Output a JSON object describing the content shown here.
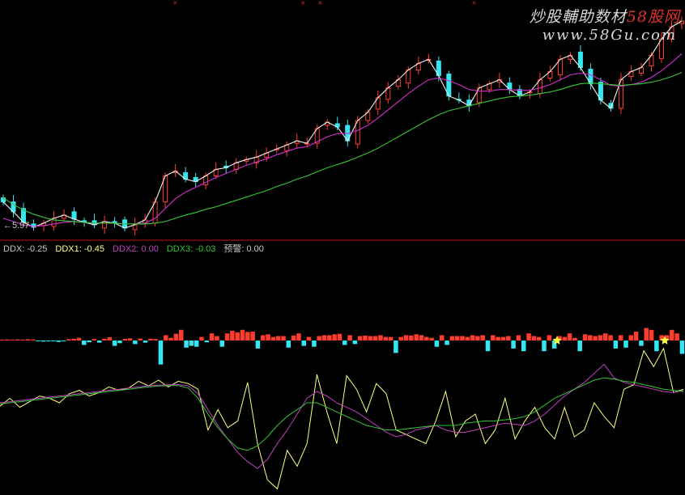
{
  "watermark": {
    "line1": "炒股輔助数材",
    "line1_brand": "58股网",
    "line2": "www.58Gu.com"
  },
  "colors": {
    "background": "#000000",
    "up": "#ff3d2e",
    "down": "#35e6f0",
    "ma_white": "#f0f0f0",
    "ma_magenta": "#d030d0",
    "ma_green": "#34c834",
    "divider": "#c0141e",
    "ddx": "#c8c8c8",
    "ddx1": "#ffff80",
    "ddx2": "#c040c0",
    "ddx3": "#34c834",
    "warn": "#c8c8c8",
    "star": "#ffff40"
  },
  "price_panel": {
    "low_marker": "←5.97"
  },
  "indicator_legend": [
    {
      "label": "DDX: -0.25",
      "color": "#c8c8c8"
    },
    {
      "label": "DDX1: -0.45",
      "color": "#ffff80"
    },
    {
      "label": "DDX2: 0.00",
      "color": "#c040c0"
    },
    {
      "label": "DDX3: -0.03",
      "color": "#34c834"
    },
    {
      "label": "预警: 0.00",
      "color": "#c8c8c8"
    }
  ],
  "chart_data": [
    {
      "type": "line",
      "panel": "price",
      "series": [
        {
          "values": [
            6.3,
            6.18,
            6.05,
            5.99,
            6.04,
            6.1,
            6.14,
            6.09,
            6.05,
            6.02,
            6.06,
            6.04,
            5.98,
            6.02,
            6.08,
            6.3,
            6.62,
            6.68,
            6.58,
            6.55,
            6.62,
            6.7,
            6.72,
            6.78,
            6.82,
            6.85,
            6.9,
            6.95,
            7.0,
            7.05,
            7.02,
            7.2,
            7.28,
            7.22,
            7.05,
            7.3,
            7.4,
            7.58,
            7.7,
            7.8,
            7.92,
            8.0,
            8.05,
            7.85,
            7.6,
            7.55,
            7.48,
            7.7,
            7.75,
            7.8,
            7.68,
            7.6,
            7.65,
            7.8,
            7.9,
            8.05,
            8.1,
            7.95,
            7.75,
            7.55,
            7.45,
            7.8,
            7.9,
            7.95,
            8.1,
            8.3,
            8.45,
            8.52
          ]
        },
        {
          "values": [
            6.1,
            6.06,
            6.02,
            6.0,
            6.01,
            6.03,
            6.05,
            6.06,
            6.05,
            6.04,
            6.04,
            6.04,
            6.03,
            6.03,
            6.04,
            6.1,
            6.22,
            6.34,
            6.42,
            6.48,
            6.54,
            6.6,
            6.65,
            6.7,
            6.75,
            6.79,
            6.83,
            6.88,
            6.92,
            6.96,
            6.98,
            7.04,
            7.1,
            7.14,
            7.14,
            7.18,
            7.24,
            7.33,
            7.43,
            7.53,
            7.63,
            7.72,
            7.8,
            7.82,
            7.79,
            7.74,
            7.68,
            7.66,
            7.66,
            7.68,
            7.68,
            7.67,
            7.67,
            7.7,
            7.74,
            7.8,
            7.86,
            7.88,
            7.86,
            7.8,
            7.73,
            7.72,
            7.74,
            7.77,
            7.83,
            7.91,
            8.01,
            8.12
          ]
        },
        {
          "values": [
            6.35,
            6.27,
            6.2,
            6.15,
            6.11,
            6.08,
            6.07,
            6.06,
            6.05,
            6.04,
            6.04,
            6.04,
            6.03,
            6.03,
            6.03,
            6.04,
            6.06,
            6.1,
            6.14,
            6.17,
            6.21,
            6.24,
            6.28,
            6.32,
            6.36,
            6.4,
            6.44,
            6.49,
            6.53,
            6.58,
            6.62,
            6.67,
            6.72,
            6.76,
            6.8,
            6.85,
            6.9,
            6.96,
            7.03,
            7.1,
            7.17,
            7.24,
            7.31,
            7.37,
            7.42,
            7.45,
            7.48,
            7.51,
            7.54,
            7.57,
            7.59,
            7.6,
            7.61,
            7.63,
            7.65,
            7.68,
            7.72,
            7.75,
            7.76,
            7.75,
            7.74,
            7.73,
            7.74,
            7.75,
            7.77,
            7.8,
            7.84,
            7.89
          ]
        }
      ]
    },
    {
      "type": "bar",
      "panel": "ddx",
      "values": [
        0.05,
        0.06,
        0.05,
        0.06,
        0.05,
        0.07,
        0.06,
        -0.04,
        -0.06,
        -0.05,
        -0.04,
        -0.08,
        -0.05,
        0.07,
        0.1,
        0.15,
        -0.25,
        -0.1,
        0.08,
        -0.12,
        0.1,
        0.18,
        -0.3,
        -0.15,
        0.09,
        0.12,
        -0.2,
        0.11,
        -0.12,
        0.1,
        0.08,
        -1.35,
        0.3,
        0.15,
        0.38,
        0.6,
        -0.4,
        -0.3,
        -0.35,
        0.2,
        -0.1,
        0.4,
        0.25,
        -0.35,
        0.4,
        0.55,
        0.45,
        0.6,
        0.48,
        0.5,
        -0.45,
        0.3,
        0.35,
        0.2,
        0.25,
        0.25,
        -0.4,
        0.28,
        0.4,
        -0.3,
        0.2,
        -0.35,
        0.25,
        0.3,
        0.3,
        0.35,
        0.38,
        -0.25,
        0.3,
        -0.2,
        0.25,
        0.28,
        0.25,
        0.25,
        0.3,
        0.2,
        0.2,
        -0.7,
        0.2,
        0.3,
        0.28,
        0.35,
        0.3,
        0.2,
        0.15,
        -0.35,
        0.3,
        -0.25,
        0.25,
        0.25,
        0.25,
        0.2,
        0.3,
        0.25,
        0.3,
        -0.6,
        0.3,
        0.2,
        0.2,
        0.25,
        -0.45,
        0.3,
        -0.6,
        0.4,
        0.25,
        0.2,
        -0.6,
        0.3,
        -0.45,
        0.25,
        0.2,
        0.4,
        0.15,
        -0.6,
        0.35,
        0.3,
        0.25,
        0.3,
        0.4,
        0.3,
        -0.45,
        0.3,
        -0.4,
        0.3,
        0.5,
        -0.3,
        0.7,
        0.6,
        -0.6,
        0.3,
        0.3,
        0.6,
        0.4,
        -0.75
      ]
    },
    {
      "type": "line",
      "panel": "ddx",
      "series": [
        {
          "values": [
            -1.15,
            -0.8,
            -1.2,
            -0.95,
            -0.7,
            -0.8,
            -1.0,
            -0.6,
            -0.45,
            -0.7,
            -0.55,
            -0.3,
            -0.45,
            -0.35,
            -0.05,
            -0.25,
            0.0,
            -0.3,
            -0.05,
            -0.15,
            -0.4,
            -2.2,
            -1.3,
            -2.1,
            -1.8,
            -0.1,
            -2.8,
            -4.4,
            -4.8,
            -3.1,
            -3.8,
            -2.8,
            0.25,
            -1.4,
            -2.8,
            0.2,
            -0.4,
            -1.4,
            -0.15,
            -0.6,
            -2.2,
            -2.4,
            -2.6,
            -2.8,
            -1.8,
            -0.5,
            -2.5,
            -1.8,
            -1.5,
            -2.8,
            -2.2,
            -0.8,
            -2.6,
            -1.8,
            -1.2,
            -2.1,
            -2.6,
            -1.2,
            -2.5,
            -2.2,
            -1.0,
            -1.6,
            -2.1,
            -0.4,
            -0.2,
            1.3,
            0.6,
            1.4,
            -0.55,
            -0.4
          ]
        },
        {
          "values": [
            -1.0,
            -0.95,
            -0.9,
            -0.85,
            -0.8,
            -0.75,
            -0.7,
            -0.65,
            -0.6,
            -0.55,
            -0.5,
            -0.45,
            -0.4,
            -0.35,
            -0.3,
            -0.25,
            -0.22,
            -0.2,
            -0.2,
            -0.25,
            -0.6,
            -1.3,
            -2.0,
            -2.6,
            -3.2,
            -3.6,
            -3.9,
            -3.5,
            -2.8,
            -2.2,
            -1.5,
            -0.8,
            -0.5,
            -0.7,
            -1.0,
            -1.2,
            -1.4,
            -1.7,
            -2.0,
            -2.3,
            -2.5,
            -2.4,
            -2.2,
            -2.1,
            -2.0,
            -2.2,
            -2.3,
            -2.3,
            -2.2,
            -2.1,
            -2.0,
            -1.9,
            -1.95,
            -2.0,
            -1.8,
            -1.5,
            -1.1,
            -0.7,
            -0.4,
            -0.1,
            0.3,
            0.7,
            0.1,
            -0.1,
            -0.2,
            -0.3,
            -0.4,
            -0.5,
            -0.55,
            -0.45
          ]
        },
        {
          "values": [
            -1.05,
            -1.0,
            -0.95,
            -0.9,
            -0.85,
            -0.8,
            -0.75,
            -0.7,
            -0.65,
            -0.6,
            -0.55,
            -0.5,
            -0.45,
            -0.4,
            -0.35,
            -0.3,
            -0.26,
            -0.24,
            -0.24,
            -0.35,
            -0.8,
            -1.5,
            -2.1,
            -2.6,
            -3.0,
            -3.1,
            -2.9,
            -2.5,
            -2.0,
            -1.6,
            -1.3,
            -1.0,
            -1.0,
            -1.2,
            -1.4,
            -1.6,
            -1.8,
            -2.0,
            -2.1,
            -2.2,
            -2.2,
            -2.15,
            -2.1,
            -2.05,
            -2.0,
            -2.0,
            -2.0,
            -1.9,
            -1.85,
            -1.8,
            -1.8,
            -1.75,
            -1.7,
            -1.6,
            -1.4,
            -1.1,
            -0.8,
            -0.6,
            -0.4,
            -0.2,
            0.0,
            0.1,
            0.05,
            -0.05,
            -0.1,
            -0.2,
            -0.3,
            -0.4,
            -0.45,
            -0.5
          ]
        }
      ]
    }
  ]
}
